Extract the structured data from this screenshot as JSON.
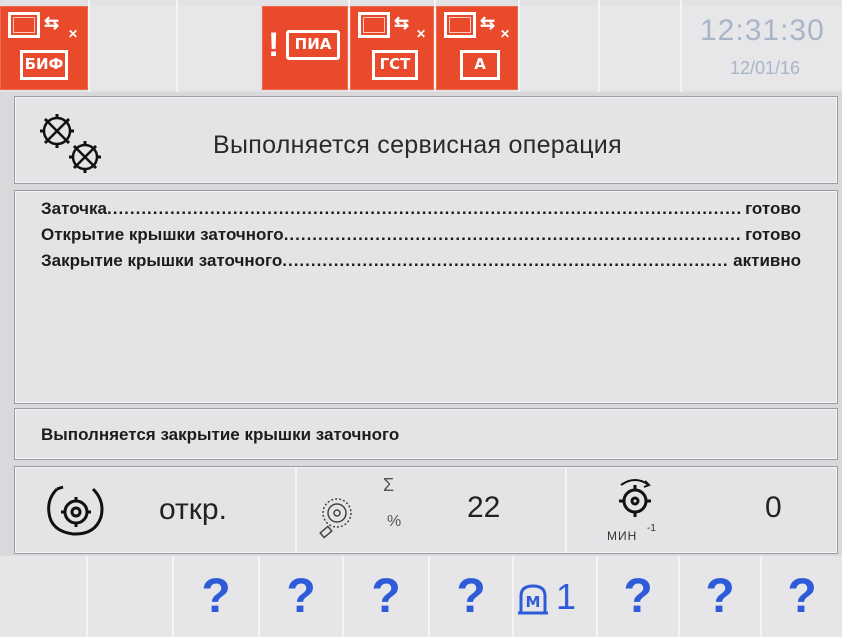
{
  "header": {
    "slots": [
      {
        "id": "buf",
        "label": "БИФ",
        "style": "red"
      },
      {
        "id": "empty1",
        "label": "",
        "style": "gray"
      },
      {
        "id": "pia",
        "label": "ПИА",
        "prefix": "!",
        "style": "red"
      },
      {
        "id": "gst",
        "label": "ГСТ",
        "style": "red"
      },
      {
        "id": "a",
        "label": "A",
        "style": "red"
      },
      {
        "id": "empty2",
        "label": "",
        "style": "gray"
      },
      {
        "id": "empty3",
        "label": "",
        "style": "gray"
      }
    ],
    "time": "12:31:30",
    "date": "12/01/16"
  },
  "title": "Выполняется сервисная операция",
  "operations": [
    {
      "label": "Заточка",
      "status": "готово"
    },
    {
      "label": "Открытие крышки заточного",
      "status": "готово"
    },
    {
      "label": "Закрытие крышки заточного",
      "status": "активно"
    }
  ],
  "status_message": "Выполняется закрытие крышки заточного",
  "info": {
    "cover_state": "откр.",
    "sharpen_count": "22",
    "speed": "0",
    "speed_unit": "МИН",
    "speed_exp": "-1",
    "sigma": "Σ",
    "percent": "%"
  },
  "softkeys": [
    "",
    "",
    "?",
    "?",
    "?",
    "?",
    "M1",
    "?",
    "?",
    "?"
  ],
  "softkey_m_num": "1",
  "softkey_m_letter": "M",
  "colors": {
    "accent_red": "#ea4a2c",
    "softkey_blue": "#2e5bd8",
    "clock_gray": "#a9b4c9"
  }
}
